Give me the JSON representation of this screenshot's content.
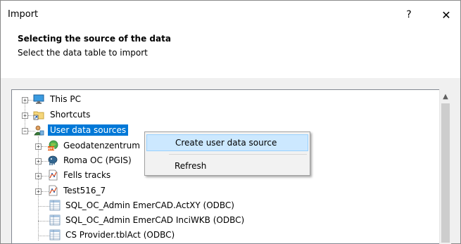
{
  "window": {
    "title": "Import",
    "help_label": "?",
    "close_label": "✕"
  },
  "header": {
    "heading": "Selecting the source of the data",
    "subheading": "Select the data table to import"
  },
  "tree": {
    "nodes": [
      {
        "label": "This PC",
        "icon": "computer-icon"
      },
      {
        "label": "Shortcuts",
        "icon": "shortcut-folder-icon"
      },
      {
        "label": "User data sources",
        "icon": "user-data-sources-icon",
        "selected": true
      },
      {
        "label": "Geodatenzentrum",
        "icon": "wfs-icon"
      },
      {
        "label": "Roma OC (PGIS)",
        "icon": "postgis-elephant-icon"
      },
      {
        "label": "Fells tracks",
        "icon": "vector-file-icon"
      },
      {
        "label": "Test516_7",
        "icon": "vector-file-icon"
      },
      {
        "label": "SQL_OC_Admin EmerCAD.ActXY (ODBC)",
        "icon": "table-icon"
      },
      {
        "label": "SQL_OC_Admin EmerCAD InciWKB (ODBC)",
        "icon": "table-icon"
      },
      {
        "label": "CS Provider.tblAct (ODBC)",
        "icon": "table-icon"
      }
    ],
    "scroll_up": "▲"
  },
  "context_menu": {
    "items": [
      {
        "label": "Create user data source",
        "highlighted": true
      },
      {
        "label": "Refresh"
      }
    ]
  },
  "colors": {
    "selection": "#0078d7",
    "menu_hover": "#cce8ff"
  }
}
